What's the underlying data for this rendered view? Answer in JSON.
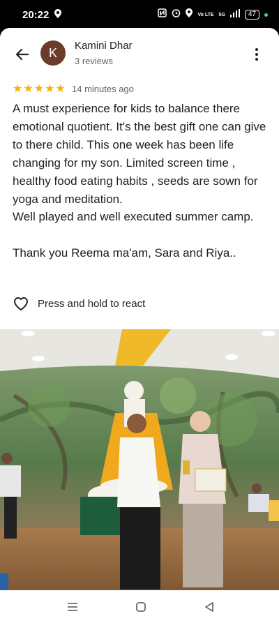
{
  "status": {
    "time": "20:22",
    "network": "5G",
    "network2": "Vo LTE",
    "battery": "47"
  },
  "header": {
    "back_icon": "arrow-left-icon",
    "avatar_letter": "K",
    "name": "Kamini Dhar",
    "reviews": "3 reviews",
    "more_icon": "more-vertical-icon"
  },
  "review": {
    "rating": 5,
    "time": "14 minutes ago",
    "paragraph1": "A must experience for kids to balance there emotional quotient. It's the best gift one can give to there child. This one week has been life changing for my son. Limited screen time , healthy food eating habits , seeds are sown for yoga and meditation.",
    "paragraph2": "Well played and well executed summer camp.",
    "paragraph3": "Thank you Reema ma'am, Sara and Riya.."
  },
  "react": {
    "icon": "heart-outline-icon",
    "label": "Press and hold to react"
  },
  "photo": {
    "icon": "award-ceremony-photo"
  },
  "nav": {
    "recents_icon": "menu-icon",
    "home_icon": "home-square-icon",
    "back_icon": "back-triangle-icon"
  },
  "colors": {
    "star": "#f4b400",
    "avatar_bg": "#6b3b2b",
    "text": "#202124",
    "secondary": "#5f6368"
  }
}
